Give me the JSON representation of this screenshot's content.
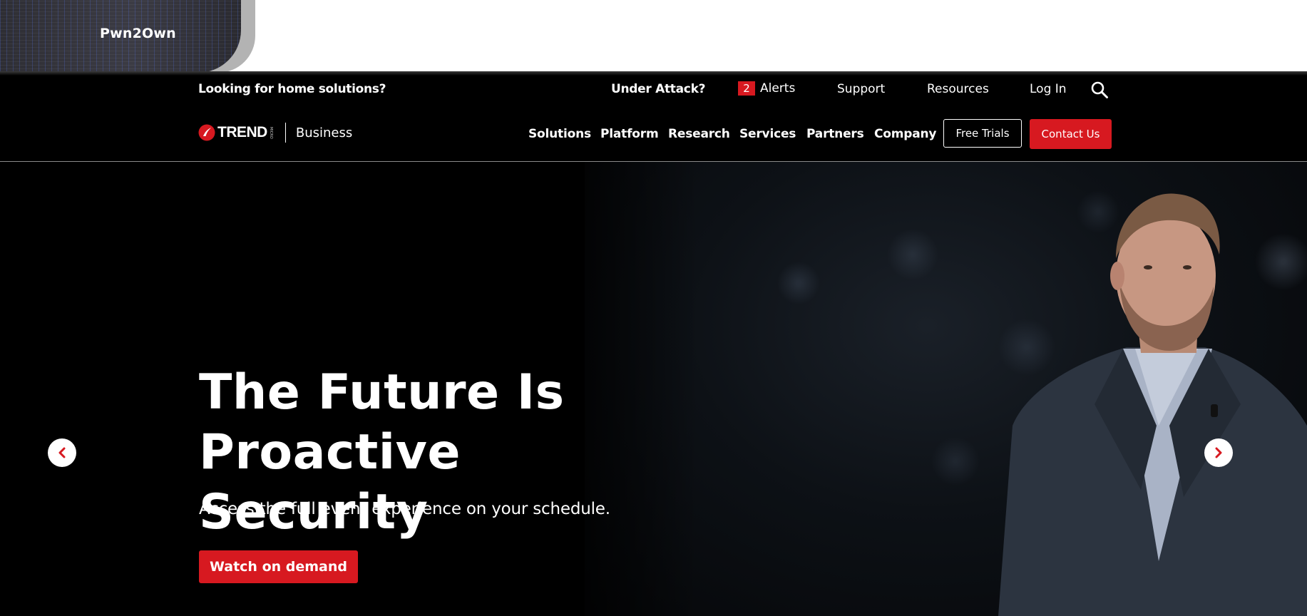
{
  "promo": {
    "label": "Pwn2Own"
  },
  "utility": {
    "home_link": "Looking for home solutions?",
    "under_attack": "Under Attack?",
    "alerts_count": "2",
    "alerts_label": "Alerts",
    "support": "Support",
    "resources": "Resources",
    "login": "Log In",
    "search_icon": "search-icon"
  },
  "brand": {
    "logo_text": "TREND",
    "logo_micro": "MICRO",
    "sub": "Business"
  },
  "nav": {
    "items": [
      "Solutions",
      "Platform",
      "Research",
      "Services",
      "Partners",
      "Company"
    ],
    "free_trials": "Free Trials",
    "contact": "Contact Us"
  },
  "hero": {
    "title_line1": "The Future Is",
    "title_line2": "Proactive Security",
    "subtitle": "Access the full event experience on your schedule.",
    "cta": "Watch on demand",
    "prev_icon": "chevron-left-icon",
    "next_icon": "chevron-right-icon"
  },
  "colors": {
    "accent_red": "#d71920",
    "background": "#000000",
    "text": "#ffffff"
  }
}
